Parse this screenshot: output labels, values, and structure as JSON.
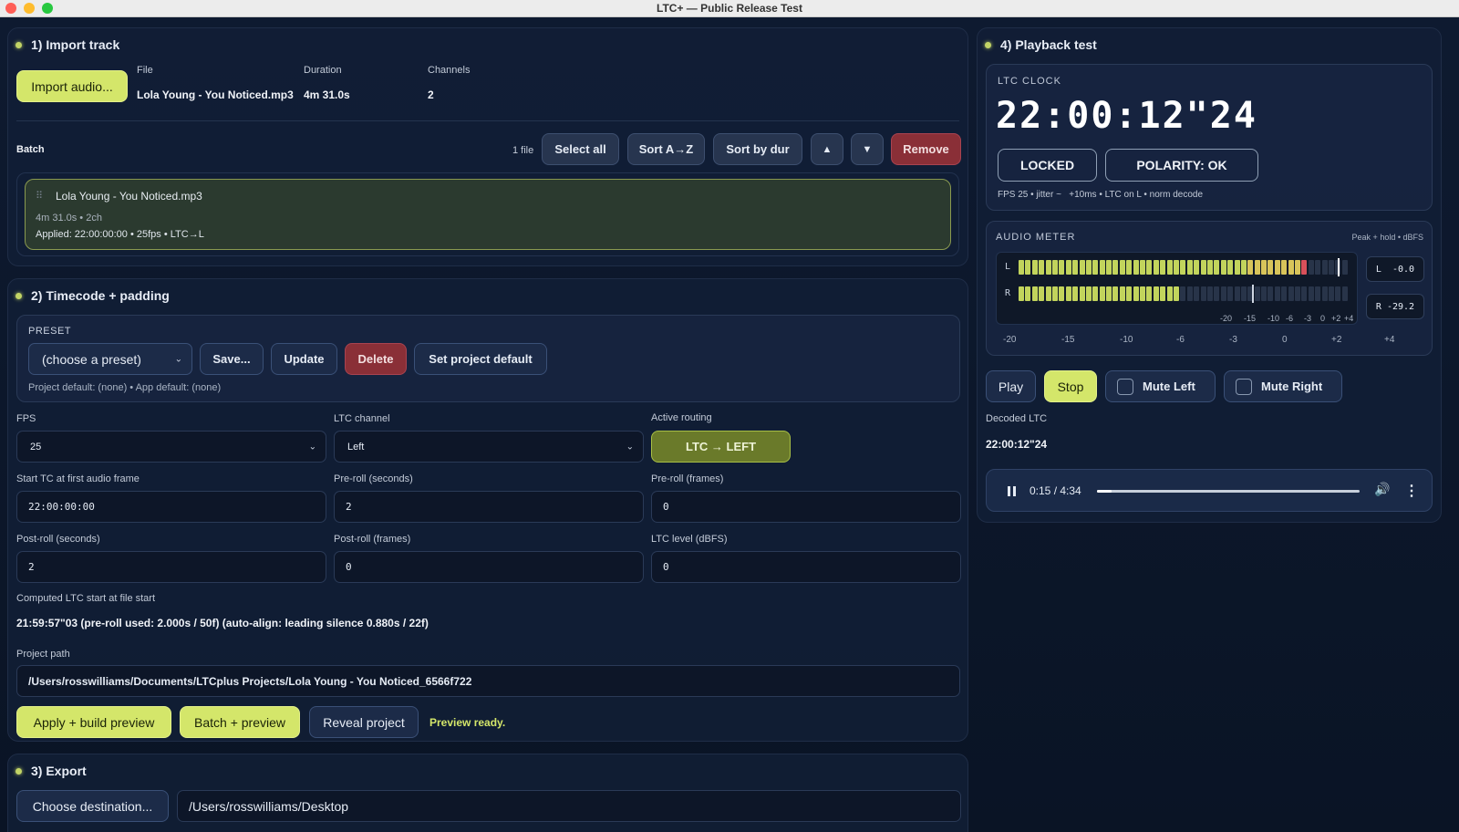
{
  "window": {
    "title": "LTC+ — Public Release Test"
  },
  "import": {
    "title": "1) Import track",
    "button": "Import audio...",
    "file_label": "File",
    "file_value": "Lola Young - You Noticed.mp3",
    "duration_label": "Duration",
    "duration_value": "4m 31.0s",
    "channels_label": "Channels",
    "channels_value": "2",
    "batch_label": "Batch",
    "batch_count": "1 file",
    "select_all": "Select all",
    "sort_az": "Sort A→Z",
    "sort_dur": "Sort by dur",
    "up": "▲",
    "down": "▼",
    "remove": "Remove",
    "item": {
      "handle": "⠿",
      "name": "Lola Young - You Noticed.mp3",
      "meta": "4m 31.0s • 2ch",
      "applied": "Applied: 22:00:00:00 • 25fps • LTC→L"
    }
  },
  "timecode": {
    "title": "2) Timecode + padding",
    "preset_label": "PRESET",
    "preset_value": "(choose a preset)",
    "save": "Save...",
    "update": "Update",
    "delete": "Delete",
    "set_default": "Set project default",
    "defaults_note": "Project default: (none) • App default: (none)",
    "fps_label": "FPS",
    "fps_value": "25",
    "ltc_channel_label": "LTC channel",
    "ltc_channel_value": "Left",
    "routing_label": "Active routing",
    "routing_value": "LTC → LEFT",
    "start_tc_label": "Start TC at first audio frame",
    "start_tc_value": "22:00:00:00",
    "preroll_s_label": "Pre-roll (seconds)",
    "preroll_s_value": "2",
    "preroll_f_label": "Pre-roll (frames)",
    "preroll_f_value": "0",
    "postroll_s_label": "Post-roll (seconds)",
    "postroll_s_value": "2",
    "postroll_f_label": "Post-roll (frames)",
    "postroll_f_value": "0",
    "level_label": "LTC level (dBFS)",
    "level_value": "0",
    "computed_label": "Computed LTC start at file start",
    "computed_value": "21:59:57\"03 (pre-roll used: 2.000s / 50f) (auto-align: leading silence 0.880s / 22f)",
    "path_label": "Project path",
    "path_value": "/Users/rosswilliams/Documents/LTCplus Projects/Lola Young - You Noticed_6566f722",
    "apply": "Apply + build preview",
    "batch": "Batch + preview",
    "reveal": "Reveal project",
    "status": "Preview ready."
  },
  "export": {
    "title": "3) Export",
    "choose": "Choose destination...",
    "dest_value": "/Users/rosswilliams/Desktop"
  },
  "playback": {
    "title": "4) Playback test",
    "clock_label": "LTC CLOCK",
    "clock_value": "22:00:12\"24",
    "locked": "LOCKED",
    "polarity": "POLARITY: OK",
    "info": "FPS 25 • jitter ~   +10ms • LTC on L • norm decode",
    "meter_label": "AUDIO METER",
    "meter_note": "Peak + hold • dBFS",
    "ch_l": "L",
    "ch_r": "R",
    "l_readout": "L  -0.0",
    "r_readout": "R -29.2",
    "l_level": 0.88,
    "r_level": 0.49,
    "inner_ticks": [
      "-20",
      "-15",
      "-10",
      "-6",
      "-3",
      "0",
      "+2",
      "+4"
    ],
    "scale": [
      "-20",
      "-15",
      "-10",
      "-6",
      "-3",
      "0",
      "+2",
      "+4"
    ],
    "play": "Play",
    "stop": "Stop",
    "mute_left": "Mute Left",
    "mute_right": "Mute Right",
    "decoded_label": "Decoded LTC",
    "decoded_value": "22:00:12\"24",
    "player_time": "0:15 / 4:34",
    "progress": 0.055
  },
  "colors": {
    "accent": "#d4e66a",
    "danger": "#8a2f37",
    "background": "#0b1322"
  }
}
